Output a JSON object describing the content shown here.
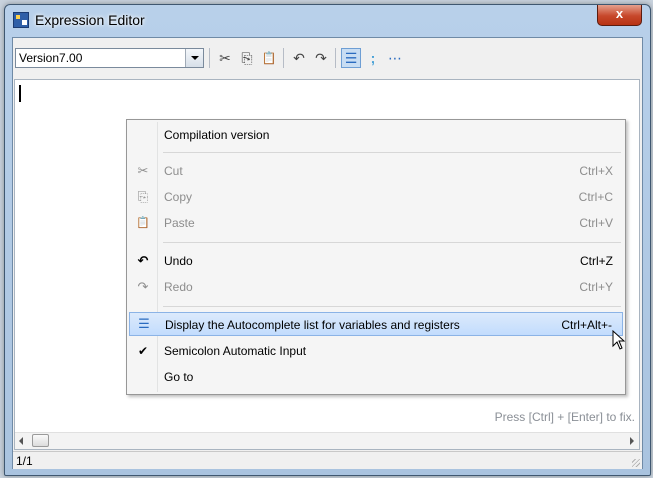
{
  "window": {
    "title": "Expression Editor",
    "close_label": "x"
  },
  "toolbar": {
    "version_value": "Version7.00",
    "buttons": [
      {
        "name": "cut-icon",
        "glyph": "✂"
      },
      {
        "name": "copy-icon",
        "glyph": "⎘"
      },
      {
        "name": "paste-icon",
        "glyph": "📋"
      },
      {
        "name": "undo-icon",
        "glyph": "↶"
      },
      {
        "name": "redo-icon",
        "glyph": "↷"
      },
      {
        "name": "autocomplete-icon",
        "glyph": "☰"
      },
      {
        "name": "semicolon-icon",
        "glyph": ";"
      },
      {
        "name": "goto-icon",
        "glyph": "⋯"
      }
    ]
  },
  "menu": {
    "items": [
      {
        "label": "Compilation version",
        "shortcut": "",
        "icon": "",
        "disabled": false
      },
      {
        "label": "Cut",
        "shortcut": "Ctrl+X",
        "icon": "✂",
        "disabled": true
      },
      {
        "label": "Copy",
        "shortcut": "Ctrl+C",
        "icon": "⎘",
        "disabled": true
      },
      {
        "label": "Paste",
        "shortcut": "Ctrl+V",
        "icon": "📋",
        "disabled": true
      },
      {
        "label": "Undo",
        "shortcut": "Ctrl+Z",
        "icon": "↶",
        "disabled": false
      },
      {
        "label": "Redo",
        "shortcut": "Ctrl+Y",
        "icon": "↷",
        "disabled": true
      },
      {
        "label": "Display the Autocomplete list for variables and registers",
        "shortcut": "Ctrl+Alt+-",
        "icon": "☰",
        "disabled": false,
        "highlighted": true
      },
      {
        "label": "Semicolon Automatic Input",
        "shortcut": "",
        "icon": "✔",
        "disabled": false,
        "checked": true
      },
      {
        "label": "Go to",
        "shortcut": "",
        "icon": "",
        "disabled": false
      }
    ]
  },
  "editor": {
    "hint": "Press [Ctrl] + [Enter] to fix."
  },
  "status": {
    "position": "1/1"
  },
  "colors": {
    "highlight": "#c2dcfd",
    "disabled_text": "#8d8d8d",
    "title_bar": "#b8d0ea"
  }
}
